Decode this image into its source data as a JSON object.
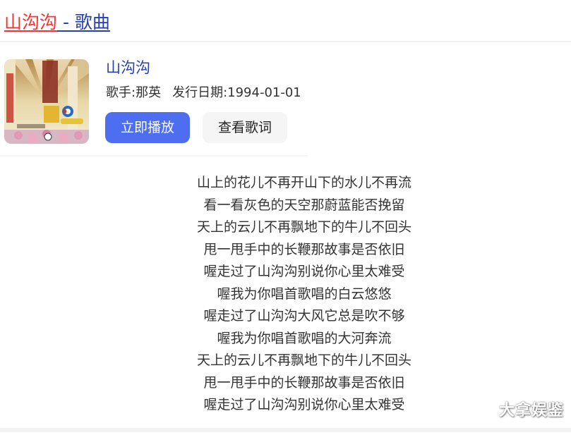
{
  "result": {
    "title_highlight": "山沟沟",
    "title_rest": " - 歌曲",
    "colors": {
      "highlight": "#f73131",
      "link": "#2440b3",
      "primary_button": "#4e6ef2"
    }
  },
  "song": {
    "name": "山沟沟",
    "singer_label": "歌手:",
    "singer": "那英",
    "release_label": "发行日期:",
    "release_date": "1994-01-01",
    "cover_icon": "album-cover-image"
  },
  "actions": {
    "play_label": "立即播放",
    "lyrics_label": "查看歌词"
  },
  "lyrics": [
    "山上的花儿不再开山下的水儿不再流",
    "看一看灰色的天空那蔚蓝能否挽留",
    "天上的云儿不再飘地下的牛儿不回头",
    "甩一甩手中的长鞭那故事是否依旧",
    "喔走过了山沟沟别说你心里太难受",
    "喔我为你唱首歌唱的白云悠悠",
    "喔走过了山沟沟大风它总是吹不够",
    "喔我为你唱首歌唱的大河奔流",
    "天上的云儿不再飘地下的牛儿不回头",
    "甩一甩手中的长鞭那故事是否依旧",
    "喔走过了山沟沟别说你心里太难受"
  ],
  "watermark": "大拿娱鉴"
}
